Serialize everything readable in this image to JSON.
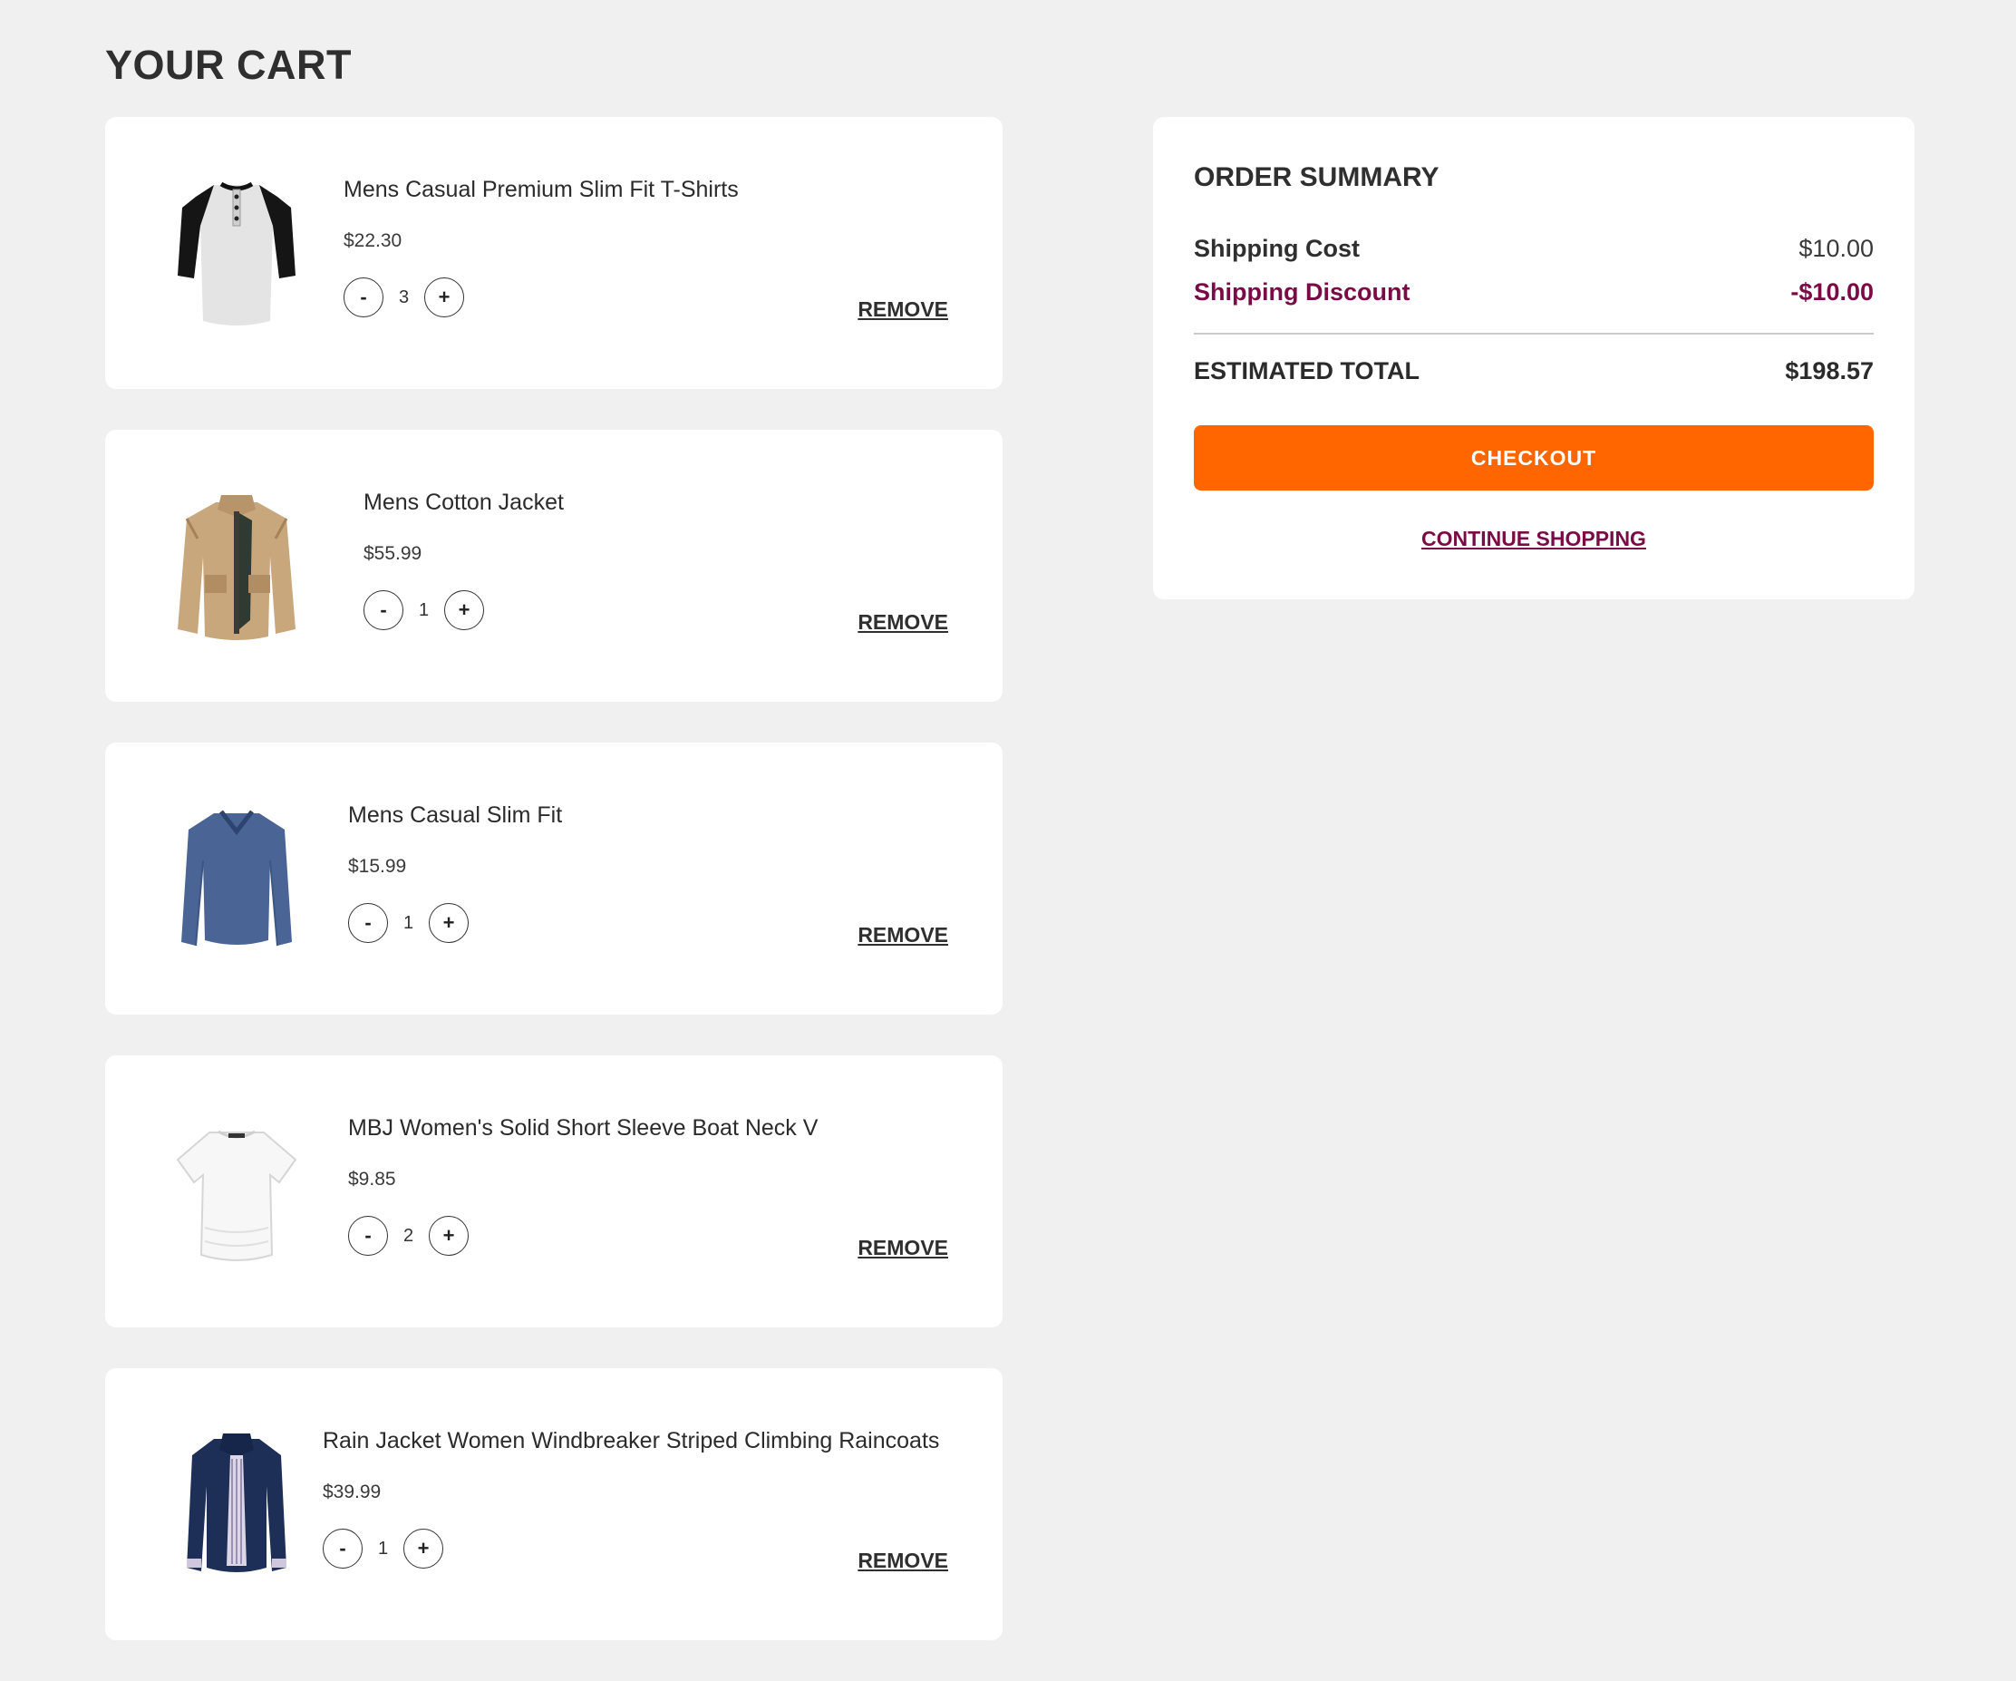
{
  "page": {
    "title": "YOUR CART"
  },
  "cart": {
    "remove_label": "REMOVE",
    "decrement_label": "-",
    "increment_label": "+",
    "items": [
      {
        "name": "Mens Casual Premium Slim Fit T-Shirts",
        "price": "$22.30",
        "quantity": "3",
        "image": "raglan-henley-shirt-icon"
      },
      {
        "name": "Mens Cotton Jacket",
        "price": "$55.99",
        "quantity": "1",
        "image": "cotton-jacket-icon"
      },
      {
        "name": "Mens Casual Slim Fit",
        "price": "$15.99",
        "quantity": "1",
        "image": "long-sleeve-shirt-icon"
      },
      {
        "name": "MBJ Women's Solid Short Sleeve Boat Neck V",
        "price": "$9.85",
        "quantity": "2",
        "image": "womens-tee-icon"
      },
      {
        "name": "Rain Jacket Women Windbreaker Striped Climbing Raincoats",
        "price": "$39.99",
        "quantity": "1",
        "image": "rain-jacket-icon"
      }
    ]
  },
  "summary": {
    "title": "ORDER SUMMARY",
    "shipping_cost_label": "Shipping Cost",
    "shipping_cost_value": "$10.00",
    "shipping_discount_label": "Shipping Discount",
    "shipping_discount_value": "-$10.00",
    "total_label": "ESTIMATED TOTAL",
    "total_value": "$198.57",
    "checkout_label": "CHECKOUT",
    "continue_label": "CONTINUE SHOPPING"
  },
  "colors": {
    "background": "#f0f0f0",
    "card": "#ffffff",
    "accent": "#ff6600",
    "discount": "#7a0b46"
  }
}
